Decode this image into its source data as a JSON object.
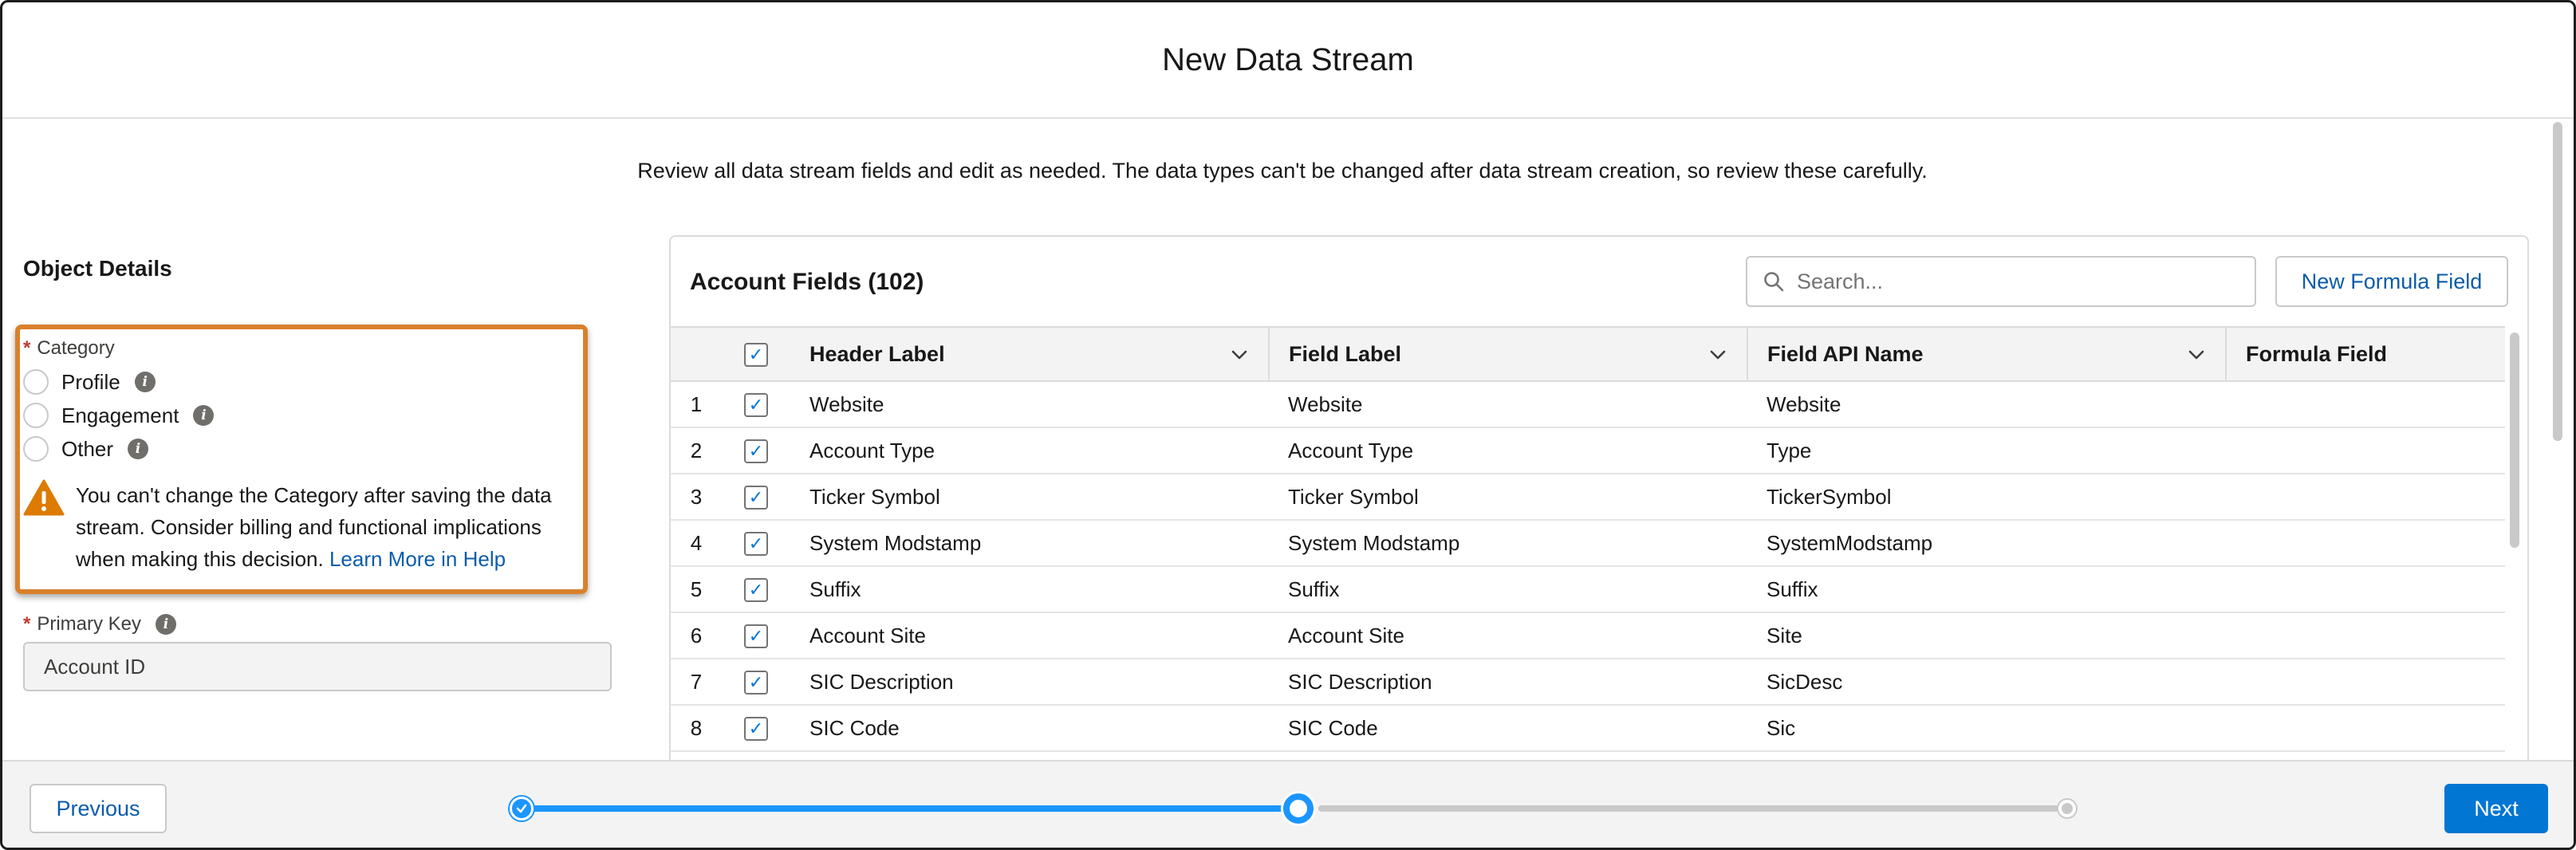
{
  "modal": {
    "title": "New Data Stream",
    "description": "Review all data stream fields and edit as needed. The data types can't be changed after data stream creation, so review these carefully."
  },
  "object_details": {
    "section_title": "Object Details",
    "category": {
      "label": "Category",
      "required_marker": "*",
      "options": [
        {
          "label": "Profile",
          "selected": false
        },
        {
          "label": "Engagement",
          "selected": false
        },
        {
          "label": "Other",
          "selected": false
        }
      ],
      "warning_text": "You can't change the Category after saving the data stream. Consider billing and functional implications when making this decision.",
      "warning_link": "Learn More in Help",
      "highlight_color": "#d9812c"
    },
    "primary_key": {
      "label": "Primary Key",
      "required_marker": "*",
      "value": "Account ID"
    }
  },
  "fields_card": {
    "title": "Account Fields (102)",
    "search_placeholder": "Search...",
    "new_formula_button": "New Formula Field",
    "columns": [
      "Header Label",
      "Field Label",
      "Field API Name",
      "Formula Field"
    ],
    "rows": [
      {
        "num": "1",
        "header_label": "Website",
        "field_label": "Website",
        "api_name": "Website",
        "checked": true
      },
      {
        "num": "2",
        "header_label": "Account Type",
        "field_label": "Account Type",
        "api_name": "Type",
        "checked": true
      },
      {
        "num": "3",
        "header_label": "Ticker Symbol",
        "field_label": "Ticker Symbol",
        "api_name": "TickerSymbol",
        "checked": true
      },
      {
        "num": "4",
        "header_label": "System Modstamp",
        "field_label": "System Modstamp",
        "api_name": "SystemModstamp",
        "checked": true
      },
      {
        "num": "5",
        "header_label": "Suffix",
        "field_label": "Suffix",
        "api_name": "Suffix",
        "checked": true
      },
      {
        "num": "6",
        "header_label": "Account Site",
        "field_label": "Account Site",
        "api_name": "Site",
        "checked": true
      },
      {
        "num": "7",
        "header_label": "SIC Description",
        "field_label": "SIC Description",
        "api_name": "SicDesc",
        "checked": true
      },
      {
        "num": "8",
        "header_label": "SIC Code",
        "field_label": "SIC Code",
        "api_name": "Sic",
        "checked": true
      }
    ]
  },
  "footer": {
    "previous_button": "Previous",
    "next_button": "Next",
    "progress": {
      "total_steps": 3,
      "current_step": 2
    },
    "accent_color": "#1b96ff",
    "brand_color": "#0176d3"
  }
}
